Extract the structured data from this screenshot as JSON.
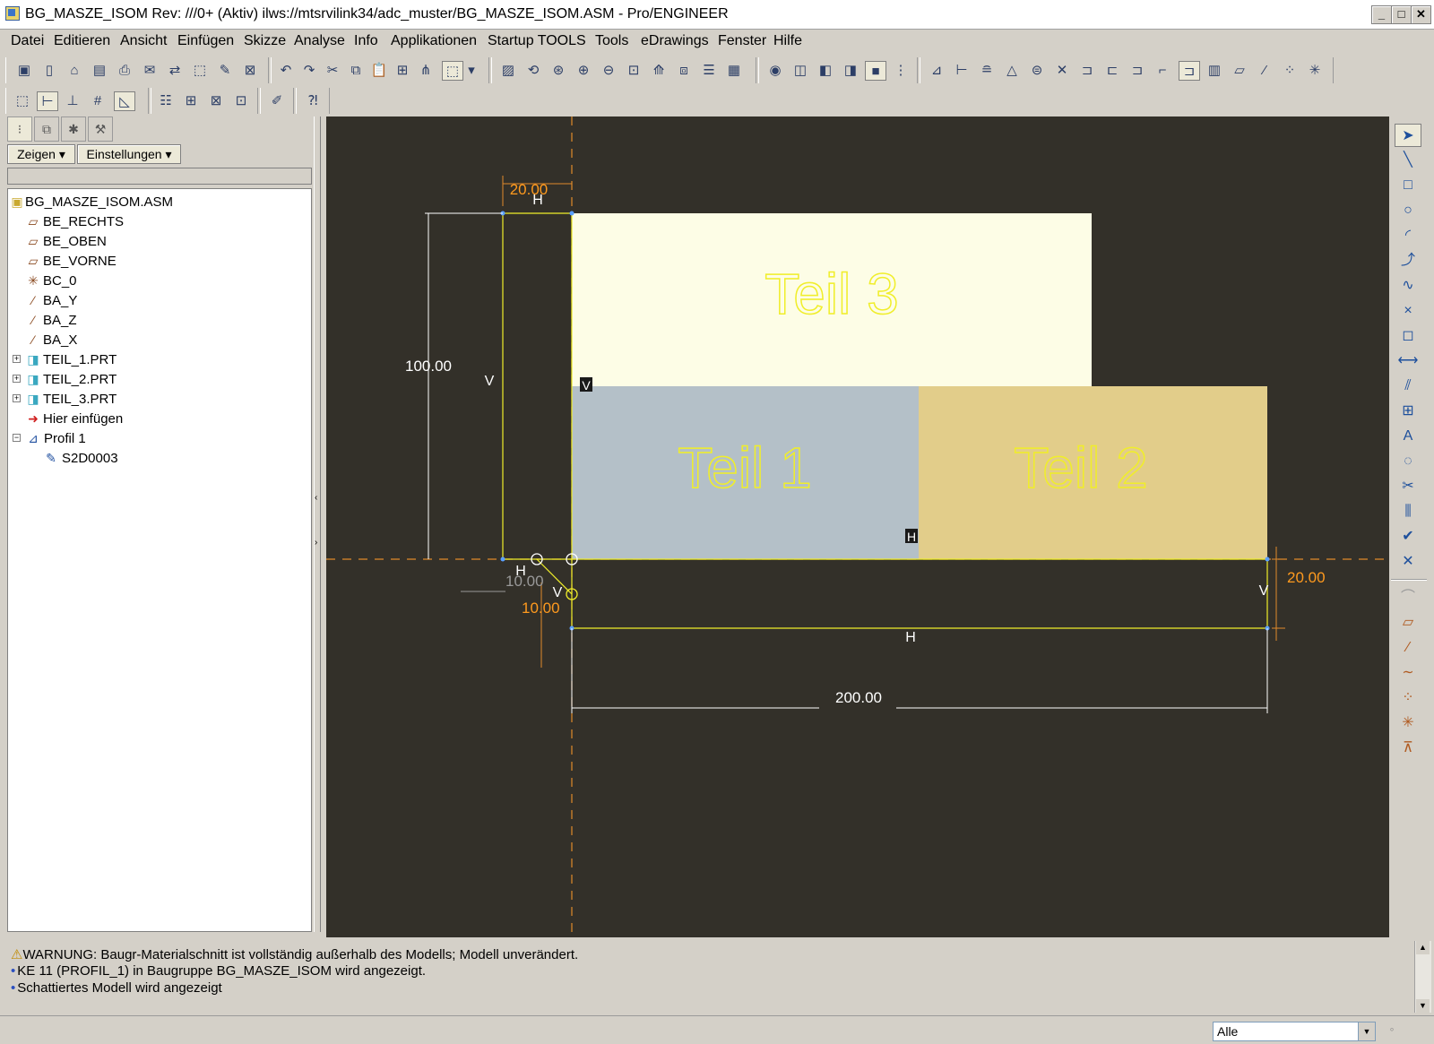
{
  "window": {
    "title": "BG_MASZE_ISOM Rev: ///0+ (Aktiv) ilws://mtsrvilink34/adc_muster/BG_MASZE_ISOM.ASM - Pro/ENGINEER",
    "minimize": "_",
    "maximize": "□",
    "close": "✕"
  },
  "menu": [
    "Datei",
    "Editieren",
    "Ansicht",
    "Einfügen",
    "Skizze",
    "Analyse",
    "Info",
    "Applikationen",
    "Startup TOOLS",
    "Tools",
    "eDrawings",
    "Fenster",
    "Hilfe"
  ],
  "panel": {
    "show_label": "Zeigen",
    "settings_label": "Einstellungen",
    "tree": [
      {
        "label": "BG_MASZE_ISOM.ASM",
        "icon": "assembly-icon"
      },
      {
        "label": "BE_RECHTS",
        "icon": "datum-plane-icon"
      },
      {
        "label": "BE_OBEN",
        "icon": "datum-plane-icon"
      },
      {
        "label": "BE_VORNE",
        "icon": "datum-plane-icon"
      },
      {
        "label": "BC_0",
        "icon": "coordinate-system-icon"
      },
      {
        "label": "BA_Y",
        "icon": "datum-axis-icon"
      },
      {
        "label": "BA_Z",
        "icon": "datum-axis-icon"
      },
      {
        "label": "BA_X",
        "icon": "datum-axis-icon"
      },
      {
        "label": "TEIL_1.PRT",
        "icon": "part-icon"
      },
      {
        "label": "TEIL_2.PRT",
        "icon": "part-icon"
      },
      {
        "label": "TEIL_3.PRT",
        "icon": "part-icon"
      },
      {
        "label": "Hier einfügen",
        "icon": "insert-here-arrow-icon"
      },
      {
        "label": "Profil 1",
        "icon": "profile-feature-icon"
      },
      {
        "label": "S2D0003",
        "icon": "sketch-icon"
      }
    ]
  },
  "sketch": {
    "parts": [
      "Teil  3",
      "Teil  1",
      "Teil  2"
    ],
    "dims": {
      "top_offset": "20.00",
      "height": "100.00",
      "width": "200.00",
      "right_offset": "20.00",
      "small_dim_a": "10.00",
      "small_dim_b": "10.00"
    },
    "constraint_h": "H",
    "constraint_v": "V"
  },
  "messages": {
    "warning": "WARNUNG: Baugr-Materialschnitt ist vollständig außerhalb des Modells; Modell unverändert.",
    "line2": "KE 11 (PROFIL_1) in Baugruppe BG_MASZE_ISOM wird angezeigt.",
    "line3": "Schattiertes Modell wird angezeigt"
  },
  "status": {
    "filter": "Alle"
  },
  "colors": {
    "canvas_bg": "#333029",
    "teil3": "#fdfde6",
    "teil1": "#b4c0c8",
    "teil2": "#e2cd8a",
    "sketch_line": "#f0ee2a",
    "dimension": "#ffffff",
    "dimension_active": "#ff9a1e"
  }
}
